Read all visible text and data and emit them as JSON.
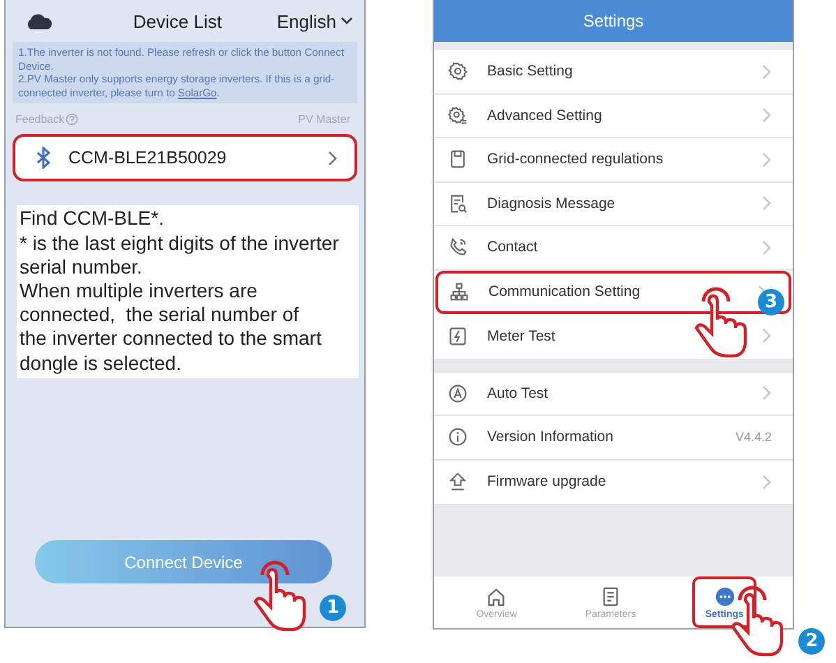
{
  "device_list": {
    "title": "Device List",
    "language": "English",
    "notice": [
      {
        "text": "1.The inverter is not found. Please refresh or click the button Connect Device."
      },
      {
        "text": "2.PV Master only supports energy storage inverters. If this is a grid-connected inverter, please turn to ",
        "link": "SolarGo",
        "after": "."
      }
    ],
    "feedback": "Feedback",
    "brand": "PV Master",
    "devices": [
      {
        "name": "CCM-BLE21B50029",
        "highlighted": true
      }
    ],
    "callout": "Find CCM-BLE*.\n* is the last eight digits of the inverter\nserial number.\nWhen multiple inverters are\nconnected,  the serial number of\nthe inverter connected to the smart\ndongle is selected.",
    "connect_button": {
      "label": "Connect Device",
      "step": "1"
    }
  },
  "settings": {
    "title": "Settings",
    "groups": [
      [
        {
          "label": "Basic Setting",
          "highlighted": false
        },
        {
          "label": "Advanced Setting",
          "highlighted": false
        },
        {
          "label": "Grid-connected regulations",
          "highlighted": false
        },
        {
          "label": "Diagnosis Message",
          "highlighted": false
        },
        {
          "label": "Contact",
          "highlighted": false
        },
        {
          "label": "Communication Setting",
          "highlighted": true,
          "step": "3"
        },
        {
          "label": "Meter Test",
          "highlighted": false
        }
      ],
      [
        {
          "label": "Auto Test",
          "highlighted": false
        },
        {
          "label": "Version Information",
          "value": "V4.4.2",
          "highlighted": false
        },
        {
          "label": "Firmware upgrade",
          "highlighted": false
        }
      ]
    ],
    "tabs": [
      {
        "label": "Overview",
        "selected": false,
        "highlighted": false
      },
      {
        "label": "Parameters",
        "selected": false,
        "highlighted": false
      },
      {
        "label": "Settings",
        "selected": true,
        "highlighted": true,
        "step": "2"
      }
    ]
  }
}
